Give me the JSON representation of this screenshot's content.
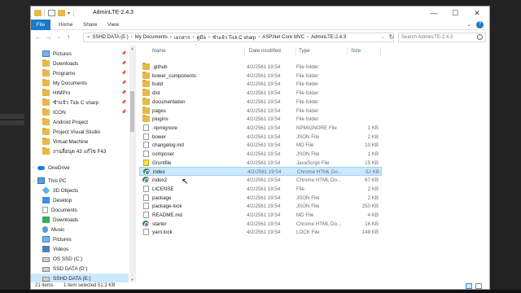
{
  "window": {
    "title": "AdminLTE-2.4.3",
    "controls": {
      "minimize": "—",
      "maximize": "☐",
      "close": "✕"
    }
  },
  "ribbon": {
    "tabs": [
      "File",
      "Home",
      "Share",
      "View"
    ],
    "help": "?",
    "collapse": "⌄"
  },
  "nav_buttons": {
    "back": "←",
    "forward": "→",
    "recent": "⌄",
    "up": "↑"
  },
  "address": {
    "crumbs": [
      "SSHD DATA (E:)",
      "My Documents",
      "เอกสาร",
      "คู่มือ",
      "ชำแจ้ว Tick C sharp",
      "ASP.Net Core MVC",
      "AdminLTE-2.4.3"
    ],
    "lead": "«",
    "separator": "›",
    "dropdown": "⌄",
    "refresh": "↻"
  },
  "search": {
    "placeholder": "Search AdminLTE-2.4.3"
  },
  "sidebar": {
    "items": [
      {
        "label": "Pictures",
        "icon": "pictures-icon",
        "pinned": true
      },
      {
        "label": "Downloads",
        "icon": "folder-icon",
        "pinned": true
      },
      {
        "label": "Programs",
        "icon": "folder-icon",
        "pinned": true
      },
      {
        "label": "My Documents",
        "icon": "folder-icon",
        "pinned": true
      },
      {
        "label": "HIMPro",
        "icon": "folder-icon",
        "pinned": true
      },
      {
        "label": "ชำแจ้ว Tick C sharp",
        "icon": "folder-icon",
        "pinned": true
      },
      {
        "label": "ICON",
        "icon": "folder-icon",
        "pinned": true
      },
      {
        "label": "Android Project",
        "icon": "folder-icon",
        "pinned": false
      },
      {
        "label": "Project Visual Studio",
        "icon": "folder-icon",
        "pinned": false
      },
      {
        "label": "Virtual Machine",
        "icon": "folder-icon",
        "pinned": false
      },
      {
        "label": "งานลื่อนุด 43 แก้ไข F43",
        "icon": "folder-icon",
        "pinned": false
      },
      {
        "label": "OneDrive",
        "icon": "onedrive-icon",
        "pinned": false
      },
      {
        "label": "This PC",
        "icon": "this-pc-icon",
        "pinned": false
      },
      {
        "label": "3D Objects",
        "icon": "3d-objects-icon",
        "pinned": false
      },
      {
        "label": "Desktop",
        "icon": "desktop-icon",
        "pinned": false
      },
      {
        "label": "Documents",
        "icon": "documents-icon",
        "pinned": false
      },
      {
        "label": "Downloads",
        "icon": "downloads-icon",
        "pinned": false
      },
      {
        "label": "Music",
        "icon": "music-icon",
        "pinned": false
      },
      {
        "label": "Pictures",
        "icon": "pictures-icon",
        "pinned": false
      },
      {
        "label": "Videos",
        "icon": "videos-icon",
        "pinned": false
      },
      {
        "label": "OS SSD (C:)",
        "icon": "drive-icon",
        "pinned": false
      },
      {
        "label": "SSD DATA (D:)",
        "icon": "drive-icon",
        "pinned": false
      },
      {
        "label": "SSHD DATA (E:)",
        "icon": "drive-icon",
        "pinned": false,
        "selected": true
      }
    ]
  },
  "columns": {
    "name": "Name",
    "date": "Date modified",
    "type": "Type",
    "size": "Size"
  },
  "files": [
    {
      "name": ".github",
      "date": "4/2/2561 19:54",
      "type": "File folder",
      "size": "",
      "icon": "folder-icon"
    },
    {
      "name": "bower_components",
      "date": "4/2/2561 19:54",
      "type": "File folder",
      "size": "",
      "icon": "folder-icon"
    },
    {
      "name": "build",
      "date": "4/2/2561 19:54",
      "type": "File folder",
      "size": "",
      "icon": "folder-icon"
    },
    {
      "name": "dist",
      "date": "4/2/2561 19:54",
      "type": "File folder",
      "size": "",
      "icon": "folder-icon"
    },
    {
      "name": "documentation",
      "date": "4/2/2561 19:54",
      "type": "File folder",
      "size": "",
      "icon": "folder-icon"
    },
    {
      "name": "pages",
      "date": "4/2/2561 19:54",
      "type": "File folder",
      "size": "",
      "icon": "folder-icon"
    },
    {
      "name": "plugins",
      "date": "4/2/2561 19:54",
      "type": "File folder",
      "size": "",
      "icon": "folder-icon"
    },
    {
      "name": ".npmignore",
      "date": "4/2/2561 19:54",
      "type": "NPMIGNORE File",
      "size": "1 KB",
      "icon": "file-icon"
    },
    {
      "name": "bower",
      "date": "4/2/2561 19:54",
      "type": "JSON File",
      "size": "2 KB",
      "icon": "file-icon"
    },
    {
      "name": "changelog.md",
      "date": "4/2/2561 19:54",
      "type": "MD File",
      "size": "10 KB",
      "icon": "file-icon"
    },
    {
      "name": "composer",
      "date": "4/2/2561 19:54",
      "type": "JSON File",
      "size": "1 KB",
      "icon": "file-icon"
    },
    {
      "name": "Gruntfile",
      "date": "4/2/2561 19:54",
      "type": "JavaScript File",
      "size": "15 KB",
      "icon": "js-file-icon"
    },
    {
      "name": "index",
      "date": "4/2/2561 19:54",
      "type": "Chrome HTML Do...",
      "size": "52 KB",
      "icon": "chrome-icon",
      "selected": true
    },
    {
      "name": "index2",
      "date": "4/2/2561 19:54",
      "type": "Chrome HTML Do...",
      "size": "67 KB",
      "icon": "chrome-icon"
    },
    {
      "name": "LICENSE",
      "date": "4/2/2561 19:54",
      "type": "File",
      "size": "2 KB",
      "icon": "file-icon"
    },
    {
      "name": "package",
      "date": "4/2/2561 19:54",
      "type": "JSON File",
      "size": "2 KB",
      "icon": "file-icon"
    },
    {
      "name": "package-lock",
      "date": "4/2/2561 19:54",
      "type": "JSON File",
      "size": "250 KB",
      "icon": "file-icon"
    },
    {
      "name": "README.md",
      "date": "4/2/2561 19:54",
      "type": "MD File",
      "size": "4 KB",
      "icon": "file-icon"
    },
    {
      "name": "starter",
      "date": "4/2/2561 19:54",
      "type": "Chrome HTML Do...",
      "size": "16 KB",
      "icon": "chrome-icon"
    },
    {
      "name": "yarn.lock",
      "date": "4/2/2561 19:54",
      "type": "LOCK File",
      "size": "148 KB",
      "icon": "file-icon"
    }
  ],
  "partial_row": {
    "date": "4/2/2561 19:54",
    "type": "Text Document",
    "size": "1 KB"
  },
  "status": {
    "count": "21 items",
    "selection": "1 item selected  51.3 KB"
  },
  "colors": {
    "accent": "#1979ca",
    "selection": "#cce8ff",
    "folder": "#e8b84b"
  }
}
